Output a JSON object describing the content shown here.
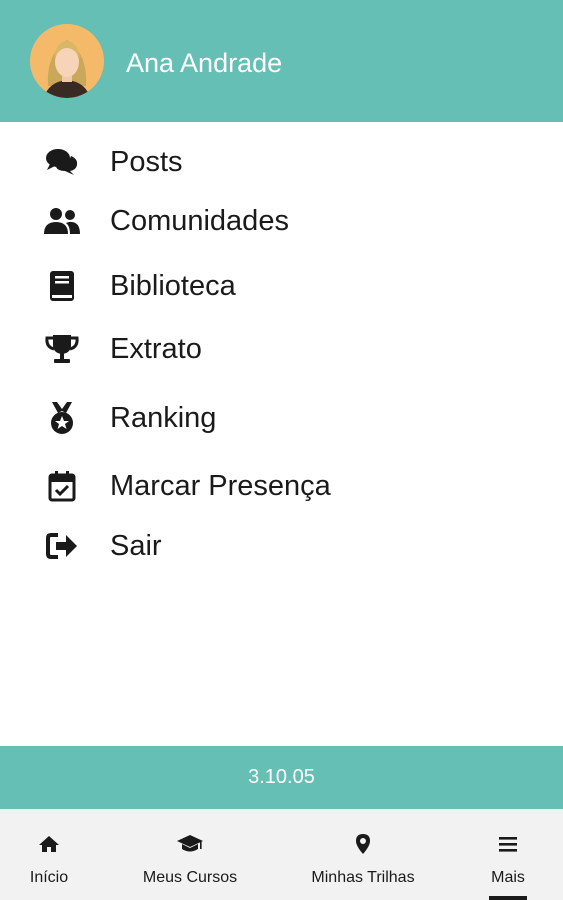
{
  "header": {
    "user_name": "Ana Andrade",
    "background_color": "#66bfb4",
    "avatar_icon": "user-avatar-female"
  },
  "menu": {
    "items": [
      {
        "label": "Posts",
        "icon": "comments-icon"
      },
      {
        "label": "Comunidades",
        "icon": "users-icon"
      },
      {
        "label": "Biblioteca",
        "icon": "book-icon"
      },
      {
        "label": "Extrato",
        "icon": "trophy-icon"
      },
      {
        "label": "Ranking",
        "icon": "medal-icon"
      },
      {
        "label": "Marcar Presença",
        "icon": "calendar-check-icon"
      },
      {
        "label": "Sair",
        "icon": "sign-out-icon"
      }
    ]
  },
  "footer": {
    "version": "3.10.05"
  },
  "bottom_nav": {
    "items": [
      {
        "label": "Início",
        "icon": "home-icon"
      },
      {
        "label": "Meus Cursos",
        "icon": "graduation-cap-icon"
      },
      {
        "label": "Minhas Trilhas",
        "icon": "map-marker-icon"
      },
      {
        "label": "Mais",
        "icon": "menu-icon",
        "active": true
      }
    ]
  }
}
